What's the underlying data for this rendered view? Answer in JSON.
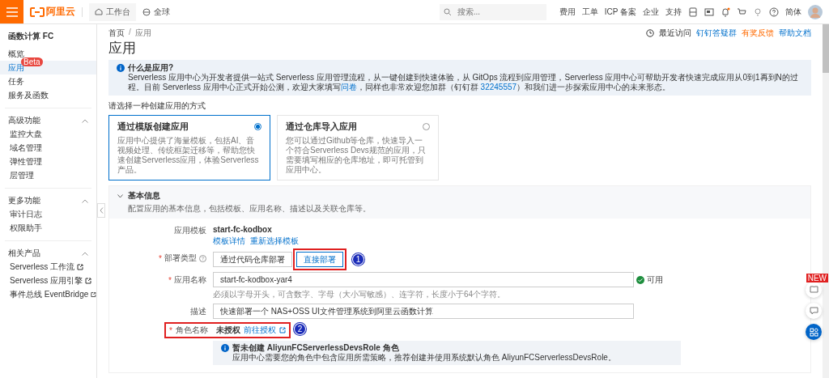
{
  "topbar": {
    "brand": "阿里云",
    "workbench": "工作台",
    "region": "全球",
    "search_placeholder": "搜索...",
    "links": [
      "费用",
      "工单",
      "ICP 备案",
      "企业",
      "支持"
    ],
    "language": "简体"
  },
  "sidebar": {
    "title": "函数计算 FC",
    "items": [
      {
        "label": "概览",
        "selected": false
      },
      {
        "label": "应用",
        "selected": true,
        "badge": "Beta"
      },
      {
        "label": "任务",
        "selected": false
      },
      {
        "label": "服务及函数",
        "selected": false
      }
    ],
    "groups": [
      {
        "title": "高级功能",
        "expanded": true,
        "items": [
          {
            "label": "监控大盘",
            "external": false
          },
          {
            "label": "域名管理",
            "external": false
          },
          {
            "label": "弹性管理",
            "external": false
          },
          {
            "label": "层管理",
            "external": false
          }
        ]
      },
      {
        "title": "更多功能",
        "expanded": true,
        "items": [
          {
            "label": "审计日志",
            "external": false
          },
          {
            "label": "权限助手",
            "external": false
          }
        ]
      },
      {
        "title": "相关产品",
        "expanded": true,
        "items": [
          {
            "label": "Serverless 工作流",
            "external": true
          },
          {
            "label": "Serverless 应用引擎",
            "external": true
          },
          {
            "label": "事件总线 EventBridge",
            "external": true
          }
        ]
      }
    ]
  },
  "main": {
    "breadcrumb": [
      "首页",
      "应用"
    ],
    "breadcrumb_separator": "/",
    "top_links": [
      {
        "label": "最近访问",
        "kind": "recent"
      },
      {
        "label": "钉钉答疑群",
        "kind": "link"
      },
      {
        "label": "有奖反馈",
        "kind": "promo"
      },
      {
        "label": "帮助文档",
        "kind": "link"
      }
    ],
    "title": "应用",
    "info": {
      "title": "什么是应用?",
      "parts": [
        {
          "kind": "text",
          "text": "Serverless 应用中心为开发者提供一站式 Serverless 应用管理流程，从一键创建到快速体验，从 GitOps 流程到应用管理，Serverless 应用中心可帮助开发者快速完成应用从0到1再到N的过程。目前 Serverless 应用中心正式开始公测，欢迎大家填写"
        },
        {
          "kind": "link",
          "text": "问卷"
        },
        {
          "kind": "text",
          "text": "，同样也非常欢迎您加群（钉钉群 "
        },
        {
          "kind": "link",
          "text": "32245557"
        },
        {
          "kind": "text",
          "text": "）和我们进一步探索应用中心的未来形态。"
        }
      ]
    },
    "prompt": "请选择一种创建应用的方式",
    "options": [
      {
        "title": "通过模版创建应用",
        "description": "应用中心提供了海量模板，包括AI、音视频处理、传统框架迁移等，帮助您快速创建Serverless应用，体验Serverless产品。",
        "selected": true
      },
      {
        "title": "通过仓库导入应用",
        "description": "您可以通过Github等仓库，快速导入一个符合Serverless Devs规范的应用，只需要填写相应的仓库地址，即可托管到应用中心。",
        "selected": false
      }
    ],
    "section": {
      "title": "基本信息",
      "subtitle": "配置应用的基本信息，包括模板、应用名称、描述以及关联仓库等。",
      "expanded": true,
      "required_mark": "*",
      "fields": [
        {
          "kind": "template",
          "label": "应用模板",
          "required": false,
          "value": "start-fc-kodbox",
          "links": [
            "模板详情",
            "重新选择模板"
          ]
        },
        {
          "kind": "segmented",
          "label": "部署类型",
          "required": true,
          "help": true,
          "options": [
            {
              "label": "通过代码仓库部署",
              "selected": false
            },
            {
              "label": "直接部署",
              "selected": true
            }
          ],
          "annotation": "1"
        },
        {
          "kind": "input",
          "label": "应用名称",
          "required": true,
          "value": "start-fc-kodbox-yar4",
          "status": "可用",
          "hint": "必须以字母开头，可含数字、字母（大小写敏感）、连字符，长度小于64个字符。"
        },
        {
          "kind": "input",
          "label": "描述",
          "required": false,
          "value": "快速部署一个 NAS+OSS UI文件管理系统到阿里云函数计算"
        },
        {
          "kind": "role",
          "label": "角色名称",
          "required": true,
          "value": "未授权",
          "link": "前往授权",
          "annotation": "2",
          "notice": {
            "title": "暂未创建 AliyunFCServerlessDevsRole 角色",
            "text": "应用中心需要您的角色中包含应用所需策略，推荐创建并使用系统默认角色 AliyunFCServerlessDevsRole。"
          }
        }
      ]
    }
  },
  "float_badge": "NEW"
}
